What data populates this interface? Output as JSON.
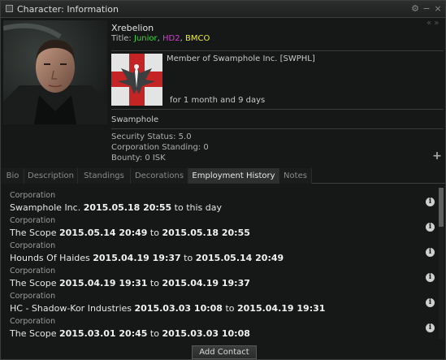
{
  "window": {
    "title": "Character: Information"
  },
  "character": {
    "name": "Xrebelion",
    "title_prefix": "Title:",
    "titles": [
      "Junior",
      "HD2",
      "BMCO"
    ],
    "title_colors": [
      "#38d638",
      "#d63ad6",
      "#ecec3a"
    ]
  },
  "corporation": {
    "member_text": "Member of Swamphole Inc. [SWPHL]",
    "duration": "for 1 month and 9 days"
  },
  "alliance": "Swamphole",
  "stats": {
    "security": "Security Status: 5.0",
    "standing": "Corporation Standing: 0",
    "bounty": "Bounty: 0 ISK"
  },
  "tabs": [
    "Bio",
    "Description",
    "Standings",
    "Decorations",
    "Employment History",
    "Notes"
  ],
  "active_tab": "Employment History",
  "history": [
    {
      "label": "Corporation",
      "corp": "Swamphole Inc.",
      "from": "2015.05.18 20:55",
      "sep": "to",
      "to": "this day"
    },
    {
      "label": "Corporation",
      "corp": "The Scope",
      "from": "2015.05.14 20:49",
      "sep": "to",
      "to": "2015.05.18 20:55"
    },
    {
      "label": "Corporation",
      "corp": "Hounds Of Haides",
      "from": "2015.04.19 19:37",
      "sep": "to",
      "to": "2015.05.14 20:49"
    },
    {
      "label": "Corporation",
      "corp": "The Scope",
      "from": "2015.04.19 19:31",
      "sep": "to",
      "to": "2015.04.19 19:37"
    },
    {
      "label": "Corporation",
      "corp": "HC - Shadow-Kor Industries",
      "from": "2015.03.03 10:08",
      "sep": "to",
      "to": "2015.04.19 19:31"
    },
    {
      "label": "Corporation",
      "corp": "The Scope",
      "from": "2015.03.01 20:45",
      "sep": "to",
      "to": "2015.03.03 10:08"
    }
  ],
  "buttons": {
    "add_contact": "Add Contact"
  },
  "icons": {
    "title_icon": "window-icon",
    "settings": "settings-icon",
    "minimize": "minimize-icon",
    "close": "close-icon",
    "info": "info-icon",
    "plus": "plus-icon",
    "collapse": "collapse-arrows-icon"
  }
}
